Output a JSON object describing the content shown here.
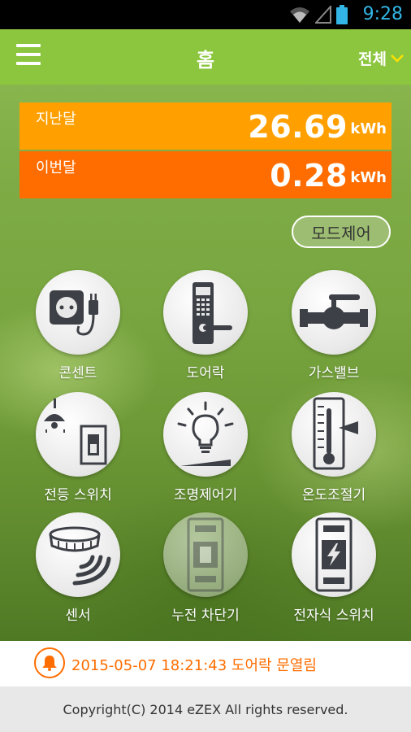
{
  "status_bar": {
    "time": "9:28",
    "icons": [
      "wifi-icon",
      "signal-icon",
      "battery-icon"
    ]
  },
  "app_bar": {
    "title": "홈",
    "filter_label": "전체",
    "menu_icon": "hamburger-menu-icon"
  },
  "energy": {
    "last_month": {
      "label": "지난달",
      "value": "26.69",
      "unit": "kWh"
    },
    "this_month": {
      "label": "이번달",
      "value": "0.28",
      "unit": "kWh"
    }
  },
  "mode_button": "모드제어",
  "devices": [
    {
      "label": "콘센트",
      "icon": "outlet-plug-icon",
      "enabled": true
    },
    {
      "label": "도어락",
      "icon": "door-lock-icon",
      "enabled": true
    },
    {
      "label": "가스밸브",
      "icon": "gas-valve-icon",
      "enabled": true
    },
    {
      "label": "전등 스위치",
      "icon": "light-switch-icon",
      "enabled": true
    },
    {
      "label": "조명제어기",
      "icon": "light-dimmer-icon",
      "enabled": true
    },
    {
      "label": "온도조절기",
      "icon": "thermostat-icon",
      "enabled": true
    },
    {
      "label": "센서",
      "icon": "smoke-sensor-icon",
      "enabled": true
    },
    {
      "label": "누전 차단기",
      "icon": "circuit-breaker-icon",
      "enabled": false
    },
    {
      "label": "전자식 스위치",
      "icon": "electronic-switch-icon",
      "enabled": true
    }
  ],
  "event": {
    "icon": "bell-icon",
    "text": "2015-05-07 18:21:43 도어락 문열림"
  },
  "footer": {
    "copyright": "Copyright(C) 2014 eZEX All rights reserved."
  },
  "colors": {
    "app_bar": "#8cc63f",
    "last_month": "#ffa000",
    "this_month": "#ff6d00",
    "status_accent": "#33b5e5"
  }
}
